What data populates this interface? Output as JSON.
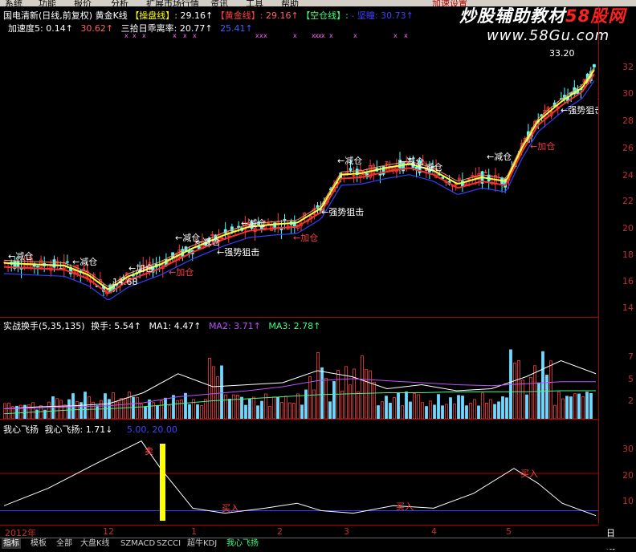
{
  "menu": [
    "系统",
    "功能",
    "报价",
    "分析",
    "扩展市场行情",
    "资讯",
    "工具",
    "帮助"
  ],
  "menu_right": "加速设置",
  "watermark": {
    "text_a": "炒股辅助教材",
    "text_b": "58股网",
    "url": "www.58Gu.com"
  },
  "main_header": {
    "stock": "国电清新(日线,前复权)",
    "indicator": "黄金K线",
    "item1_label": "【操盘线】:",
    "item1_value": "29.16↑",
    "item2_label": "【黄金线】:",
    "item2_value": "29.16↑",
    "item3_label": "【空仓线】:",
    "item3_value": "- 坚瞳: 30.73↑",
    "row2_a": "加速度5: 0.14↑",
    "row2_b": "30.62↑",
    "row2_c": "三拾日乖离率: 20.77↑",
    "row2_d": "25.41↑"
  },
  "price_axis": [
    "32",
    "30",
    "28",
    "26",
    "24",
    "22",
    "20",
    "18",
    "16",
    "14"
  ],
  "price_annotations": [
    {
      "text": "←减仓"
    },
    {
      "text": "←减仓"
    },
    {
      "text": "←加仓"
    },
    {
      "text": "14.68"
    },
    {
      "text": "←减仓"
    },
    {
      "text": "←减仓"
    },
    {
      "text": "←加仓"
    },
    {
      "text": "←减仓"
    },
    {
      "text": "←强势狙击"
    },
    {
      "text": "←加仓"
    },
    {
      "text": "←减仓"
    },
    {
      "text": "←强势狙击"
    },
    {
      "text": "←减仓"
    },
    {
      "text": "←减仓"
    },
    {
      "text": "←减仓"
    },
    {
      "text": "←强势狙击"
    },
    {
      "text": "←加仓"
    },
    {
      "text": "33.20"
    },
    {
      "text": "加"
    }
  ],
  "vol_header": {
    "name": "实战换手(5,35,135)",
    "hs": "换手: 5.54↑",
    "ma1": "MA1: 4.47↑",
    "ma2": "MA2: 3.71↑",
    "ma3": "MA3: 2.78↑"
  },
  "vol_axis": [
    "7",
    "5",
    "2"
  ],
  "osc_header": {
    "name": "我心飞扬",
    "value": "我心飞扬: 1.71↓",
    "levels": "5.00, 20.00"
  },
  "osc_axis": [
    "30",
    "20",
    "10"
  ],
  "osc_labels": [
    {
      "text": "卖"
    },
    {
      "text": "买入"
    },
    {
      "text": "买入"
    },
    {
      "text": "买入"
    }
  ],
  "x_axis": [
    "2012年",
    "12",
    "1",
    "2",
    "3",
    "4",
    "5"
  ],
  "x_axis_right": "日线",
  "tabs": [
    "指标",
    "模板",
    "全部",
    "大盘K线",
    "SZMACD",
    "SZCCI",
    "超牛KDJ",
    "我心飞扬"
  ],
  "colors": {
    "up": "#ff3b3b",
    "down": "#54ffff",
    "gold": "#ffff40",
    "trend": "#ff9060",
    "bg": "#000000"
  },
  "chart_data": [
    {
      "type": "line",
      "title": "",
      "xlabel": "",
      "ylabel": "",
      "ylim": [
        13,
        33
      ],
      "x": [
        "2012-11",
        "2012-12",
        "2013-01",
        "2013-02",
        "2013-03",
        "2013-04",
        "2013-05"
      ],
      "series": [
        {
          "values": [
            16.8,
            16.2,
            15.8,
            17.5,
            19.5,
            23.5,
            23.2,
            29.2
          ]
        },
        {
          "values": [
            16.9,
            16.1,
            15.9,
            17.2,
            19.0,
            22.8,
            23.0,
            29.2
          ]
        }
      ]
    },
    {
      "type": "bar",
      "title": "",
      "ylim": [
        0,
        9
      ],
      "series": [
        {
          "name": "换手",
          "values": [
            5.54
          ]
        },
        {
          "name": "MA1",
          "values": [
            4.47
          ]
        },
        {
          "name": "MA2",
          "values": [
            3.71
          ]
        },
        {
          "name": "MA3",
          "values": [
            2.78
          ]
        }
      ]
    },
    {
      "type": "line",
      "title": "",
      "ylim": [
        0,
        36
      ],
      "series": [
        {
          "name": "我心飞扬",
          "values": [
            7,
            20,
            33,
            6,
            5,
            5,
            8,
            5,
            22,
            8,
            1.71
          ]
        }
      ]
    }
  ]
}
